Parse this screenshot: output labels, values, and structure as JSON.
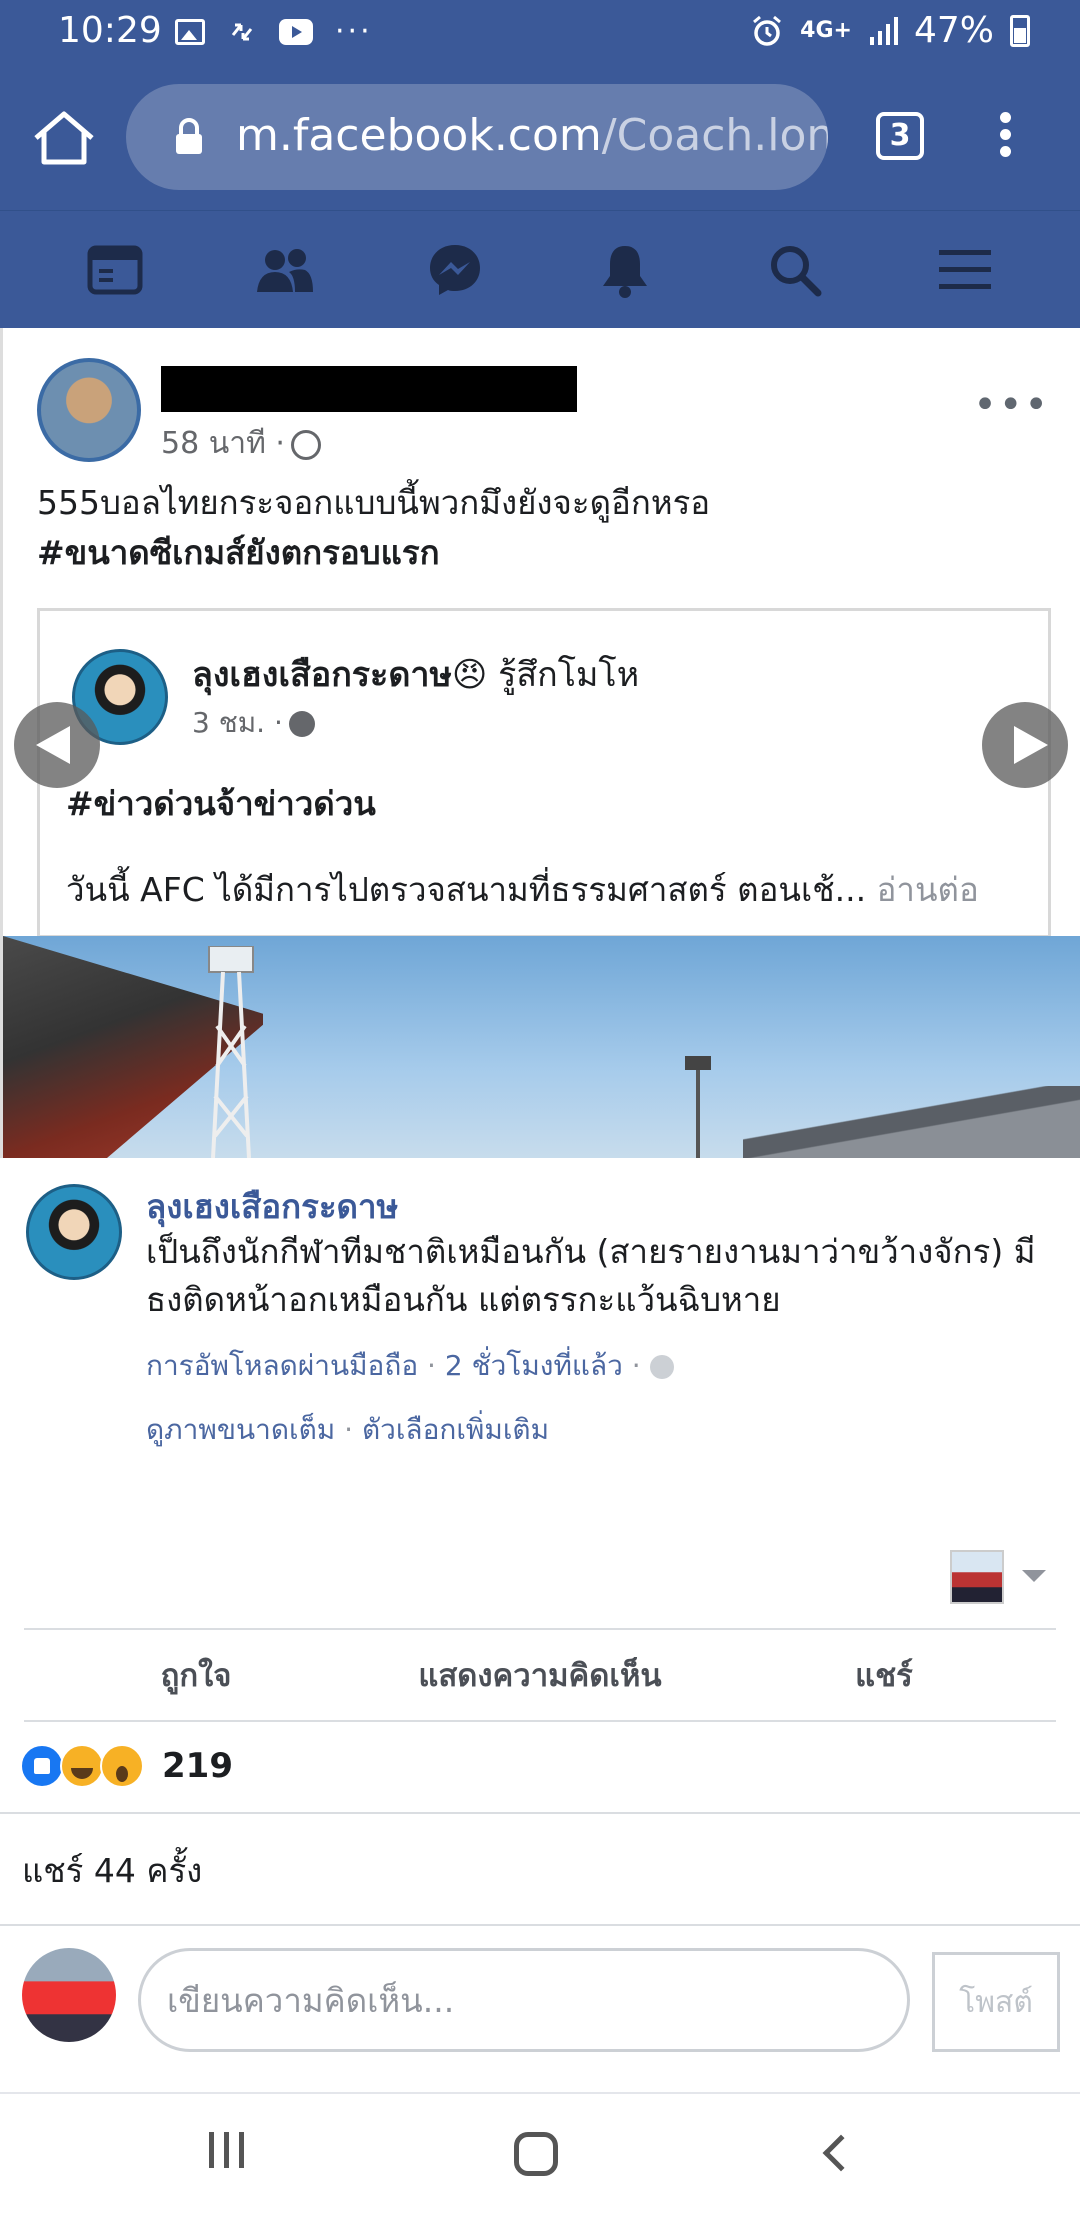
{
  "status_bar": {
    "time": "10:29",
    "network": "4G+",
    "battery": "47%",
    "icons": [
      "image-icon",
      "sync-icon",
      "youtube-icon",
      "more-dots",
      "alarm-icon",
      "signal-icon",
      "battery-icon"
    ]
  },
  "browser": {
    "url_domain": "m.facebook.com",
    "url_path": "/Coach.lon",
    "tab_count": "3"
  },
  "fb_nav": {
    "items": [
      "news-feed-icon",
      "friends-icon",
      "messenger-icon",
      "notifications-icon",
      "search-icon",
      "menu-icon"
    ]
  },
  "post": {
    "time": "58 นาที ·",
    "text_line1": "555บอลไทยกระจอกแบบนี้พวกมึงยังจะดูอีกหรอ",
    "hashtag": "#ขนาดซีเกมส์ยังตกรอบแรก",
    "embed": {
      "page_name": "ลุงเฮงเสือกระดาษ",
      "feeling": "😠 รู้สึกโมโห",
      "time": "3 ชม. ·",
      "hashtag": "#ข่าวด่วนจ้าข่าวด่วน",
      "body": "วันนี้ AFC ได้มีการไปตรวจสนามที่ธรรมศาสตร์ ตอนเช้...",
      "read_more": " อ่านต่อ"
    }
  },
  "caption": {
    "page_name": "ลุงเฮงเสือกระดาษ",
    "text": "เป็นถึงนักกีฬาทีมชาติเหมือนกัน (สายรายงานมาว่าขว้างจักร) มีธงติดหน้าอกเหมือนกัน แต่ตรรกะแว้นฉิบหาย",
    "upload_source": "การอัพโหลดผ่านมือถือ",
    "upload_time": "2 ชั่วโมงที่แล้ว",
    "view_full": "ดูภาพขนาดเต็ม",
    "more_options": "ตัวเลือกเพิ่มเติม"
  },
  "actions": {
    "like": "ถูกใจ",
    "comment": "แสดงความคิดเห็น",
    "share": "แชร์"
  },
  "reactions": {
    "types": [
      "like",
      "haha",
      "wow"
    ],
    "count": "219"
  },
  "shares": {
    "text": "แชร์ 44 ครั้ง"
  },
  "composer": {
    "placeholder": "เขียนความคิดเห็น...",
    "post_label": "โพสต์"
  },
  "colors": {
    "facebook_blue": "#3b5998",
    "link_blue": "#4b67a1",
    "muted": "#90949c"
  }
}
